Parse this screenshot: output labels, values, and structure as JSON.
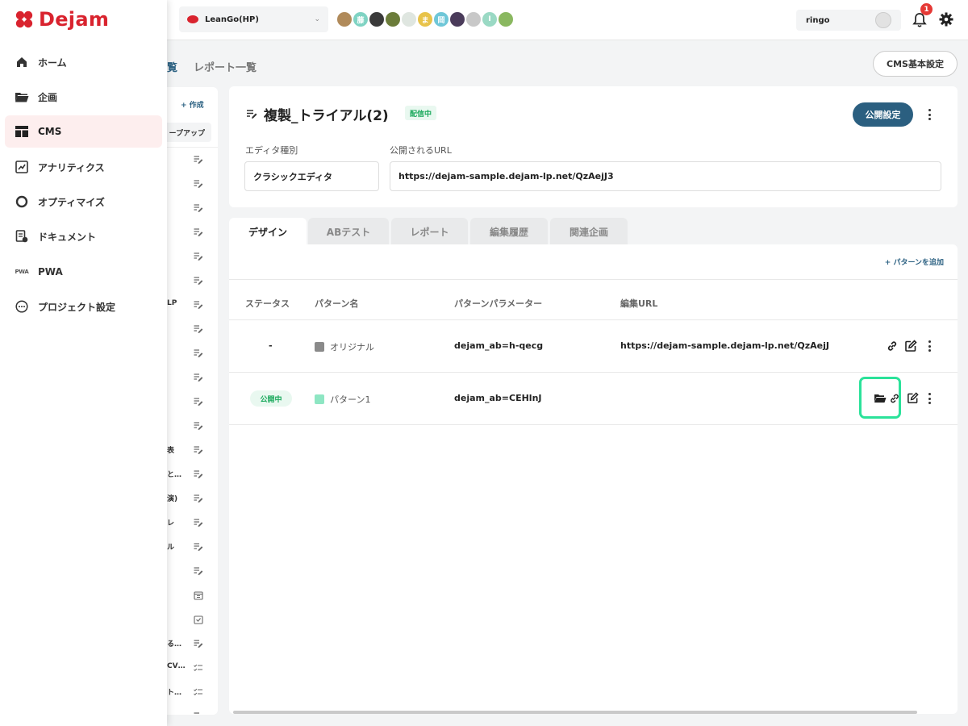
{
  "brand": {
    "name": "Dejam",
    "color": "#d9232e"
  },
  "topbar": {
    "project_name": "LeanGo(HP)",
    "avatars": [
      {
        "label": "",
        "color": "#b08a5a"
      },
      {
        "label": "藤",
        "color": "#7fd3c3"
      },
      {
        "label": "",
        "color": "#3a3a3a"
      },
      {
        "label": "",
        "color": "#6b7c3a"
      },
      {
        "label": "",
        "color": "#dfe6e0"
      },
      {
        "label": "ま",
        "color": "#e8c34a"
      },
      {
        "label": "岡",
        "color": "#6fc7d8"
      },
      {
        "label": "",
        "color": "#4a3b5a"
      },
      {
        "label": "",
        "color": "#c8c8c8"
      },
      {
        "label": "I",
        "color": "#9ad9c4"
      },
      {
        "label": "",
        "color": "#8ab860"
      }
    ],
    "user_name": "ringo",
    "notification_count": "1"
  },
  "sidenav": {
    "items": [
      {
        "label": "ホーム",
        "icon": "home-icon",
        "active": false
      },
      {
        "label": "企画",
        "icon": "folder-icon",
        "active": false
      },
      {
        "label": "CMS",
        "icon": "layout-icon",
        "active": true
      },
      {
        "label": "アナリティクス",
        "icon": "analytics-icon",
        "active": false
      },
      {
        "label": "オプティマイズ",
        "icon": "optimize-icon",
        "active": false
      },
      {
        "label": "ドキュメント",
        "icon": "document-icon",
        "active": false
      },
      {
        "label": "PWA",
        "icon": "pwa-icon",
        "active": false
      },
      {
        "label": "プロジェクト設定",
        "icon": "more-circle-icon",
        "active": false
      }
    ],
    "pwa_icon_text": "PWA"
  },
  "header": {
    "tab_list_fragment": "覧",
    "tab_report_list": "レポート一覧",
    "cms_settings_button": "CMS基本設定"
  },
  "list_panel": {
    "create_label": "+ 作成",
    "group_button": "ープアップ",
    "row_fragments": [
      "",
      "",
      "",
      "",
      "",
      "",
      "LP",
      "",
      "",
      "",
      "",
      "",
      "表",
      "と…",
      "演)",
      "レ",
      "ル",
      "",
      "",
      "",
      "る…",
      "CV…",
      "ト…",
      ""
    ],
    "row_icons": [
      "edit",
      "edit",
      "edit",
      "edit",
      "edit",
      "edit",
      "edit",
      "edit",
      "edit",
      "edit",
      "edit",
      "edit",
      "edit",
      "edit",
      "edit",
      "edit",
      "edit",
      "edit",
      "calendar",
      "inbox",
      "edit",
      "checklist",
      "checklist",
      "edit"
    ]
  },
  "page": {
    "title": "複製_トライアル(2)",
    "status": "配信中",
    "publish_button": "公開設定",
    "editor_type_label": "エディタ種別",
    "editor_type_value": "クラシックエディタ",
    "public_url_label": "公開されるURL",
    "public_url_value": "https://dejam-sample.dejam-lp.net/QzAejJ3"
  },
  "tabs": [
    "デザイン",
    "ABテスト",
    "レポート",
    "編集履歴",
    "関連企画"
  ],
  "patterns": {
    "add_button": "+ パターンを追加",
    "headers": [
      "ステータス",
      "パターン名",
      "パターンパラメーター",
      "編集URL"
    ],
    "rows": [
      {
        "status": "-",
        "name": "オリジナル",
        "swatch": "#8a8a8a",
        "param": "dejam_ab=h-qecg",
        "url": "https://dejam-sample.dejam-lp.net/QzAejJ"
      },
      {
        "status": "公開中",
        "name": "パターン1",
        "swatch": "#8ee6c3",
        "param": "dejam_ab=CEHlnJ",
        "url": ""
      }
    ]
  }
}
